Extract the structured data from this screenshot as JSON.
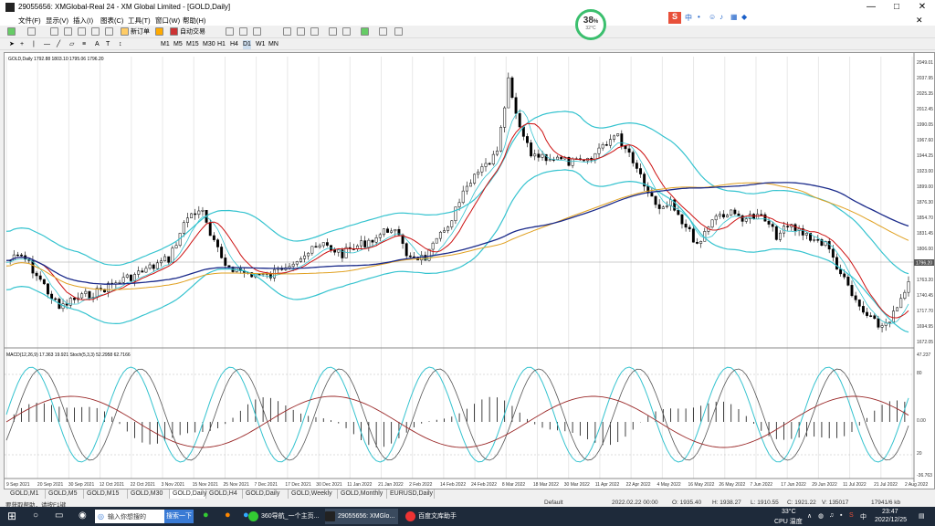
{
  "window": {
    "title": "29055656: XMGlobal-Real 24 - XM Global Limited - [GOLD,Daily]",
    "buttons": [
      "—",
      "□",
      "✕"
    ]
  },
  "menu": [
    "文件(F)",
    "显示(V)",
    "插入(I)",
    "图表(C)",
    "工具(T)",
    "窗口(W)",
    "帮助(H)"
  ],
  "toolbar": {
    "new_order": "新订单",
    "auto_trading": "自动交易",
    "timeframes": [
      "M1",
      "M5",
      "M15",
      "M30",
      "H1",
      "H4",
      "D1",
      "W1",
      "MN"
    ]
  },
  "gauge": {
    "percent": "38",
    "unit": "%",
    "temp": "32°C"
  },
  "chart": {
    "header": "GOLD,Daily  1792.88 1803.10 1795.06 1796.20",
    "price_ticks": [
      "2049.01",
      "2037.95",
      "2025.35",
      "2012.45",
      "1990.05",
      "1967.60",
      "1944.25",
      "1923.00",
      "1899.00",
      "1876.30",
      "1854.70",
      "1831.45",
      "1806.00",
      "1785.00",
      "1763.20",
      "1740.45",
      "1717.70",
      "1694.95",
      "1672.05"
    ],
    "current_price_label": "1796.20",
    "macd_header": "MACD(12,26,9) 17.363 19.921 Stoch(5,3,3) 52.2958 62.7166",
    "macd_ticks": [
      "47.237",
      "80",
      "0.00",
      "20",
      "-36.763"
    ],
    "date_ticks": [
      "9 Sep 2021",
      "20 Sep 2021",
      "30 Sep 2021",
      "12 Oct 2021",
      "22 Oct 2021",
      "3 Nov 2021",
      "15 Nov 2021",
      "25 Nov 2021",
      "7 Dec 2021",
      "17 Dec 2021",
      "30 Dec 2021",
      "11 Jan 2022",
      "21 Jan 2022",
      "2 Feb 2022",
      "14 Feb 2022",
      "24 Feb 2022",
      "8 Mar 2022",
      "18 Mar 2022",
      "30 Mar 2022",
      "11 Apr 2022",
      "22 Apr 2022",
      "4 May 2022",
      "16 May 2022",
      "26 May 2022",
      "7 Jun 2022",
      "17 Jun 2022",
      "29 Jun 2022",
      "11 Jul 2022",
      "21 Jul 2022",
      "2 Aug 2022"
    ]
  },
  "tabs": [
    "GOLD,M1",
    "GOLD,M5",
    "GOLD,M15",
    "GOLD,M30",
    "GOLD,Daily",
    "GOLD,H4",
    "GOLD,Daily",
    "GOLD,Weekly",
    "GOLD,Monthly",
    "EURUSD,Daily"
  ],
  "status": {
    "help": "要获取帮助，请按F1键",
    "profile": "Default",
    "time": "2022.02.22 00:00",
    "open": "O: 1935.40",
    "high": "H: 1938.27",
    "low": "L: 1910.55",
    "close": "C: 1921.22",
    "volume": "V: 135017",
    "traffic": "17941/6 kb"
  },
  "taskbar": {
    "search_placeholder": "输入你想搜的",
    "search_button": "搜索一下",
    "apps": [
      "360导航_一个主页...",
      "29055656: XMGlo...",
      "百度文库助手"
    ],
    "weather": "33°C",
    "cpu": "CPU 温度",
    "clock_time": "23:47",
    "clock_date": "2022/12/25",
    "ime": "中"
  }
}
